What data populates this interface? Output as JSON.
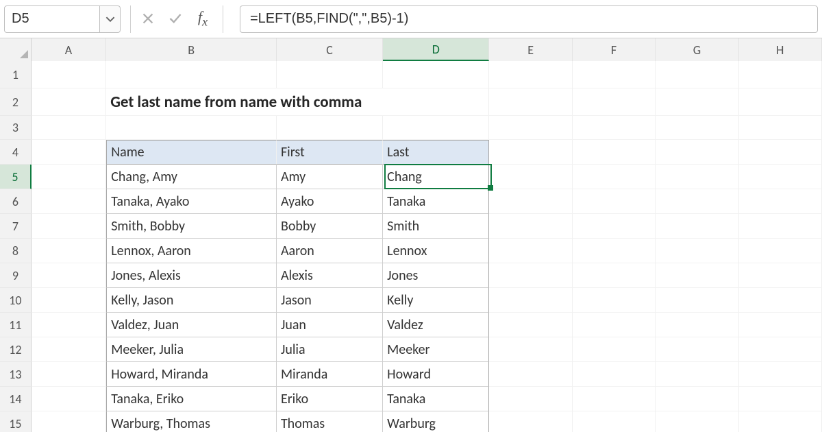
{
  "formula_bar": {
    "cell_ref": "D5",
    "formula": "=LEFT(B5,FIND(\",\",B5)-1)"
  },
  "columns": {
    "A": "A",
    "B": "B",
    "C": "C",
    "D": "D",
    "E": "E",
    "F": "F",
    "G": "G",
    "H": "H"
  },
  "row_numbers": [
    "1",
    "2",
    "3",
    "4",
    "5",
    "6",
    "7",
    "8",
    "9",
    "10",
    "11",
    "12",
    "13",
    "14",
    "15"
  ],
  "sheet": {
    "title": "Get last name from name with comma",
    "headers": {
      "name": "Name",
      "first": "First",
      "last": "Last"
    },
    "rows": [
      {
        "name": "Chang, Amy",
        "first": "Amy",
        "last": "Chang"
      },
      {
        "name": "Tanaka, Ayako",
        "first": "Ayako",
        "last": "Tanaka"
      },
      {
        "name": "Smith, Bobby",
        "first": "Bobby",
        "last": "Smith"
      },
      {
        "name": "Lennox, Aaron",
        "first": "Aaron",
        "last": "Lennox"
      },
      {
        "name": "Jones, Alexis",
        "first": "Alexis",
        "last": "Jones"
      },
      {
        "name": "Kelly, Jason",
        "first": "Jason",
        "last": "Kelly"
      },
      {
        "name": "Valdez, Juan",
        "first": "Juan",
        "last": "Valdez"
      },
      {
        "name": "Meeker, Julia",
        "first": "Julia",
        "last": "Meeker"
      },
      {
        "name": "Howard, Miranda",
        "first": "Miranda",
        "last": "Howard"
      },
      {
        "name": "Tanaka, Eriko",
        "first": "Eriko",
        "last": "Tanaka"
      },
      {
        "name": "Warburg, Thomas",
        "first": "Thomas",
        "last": "Warburg"
      }
    ]
  },
  "active_cell": "D5",
  "colors": {
    "excel_green": "#107c41",
    "header_blue": "#dde7f3"
  }
}
